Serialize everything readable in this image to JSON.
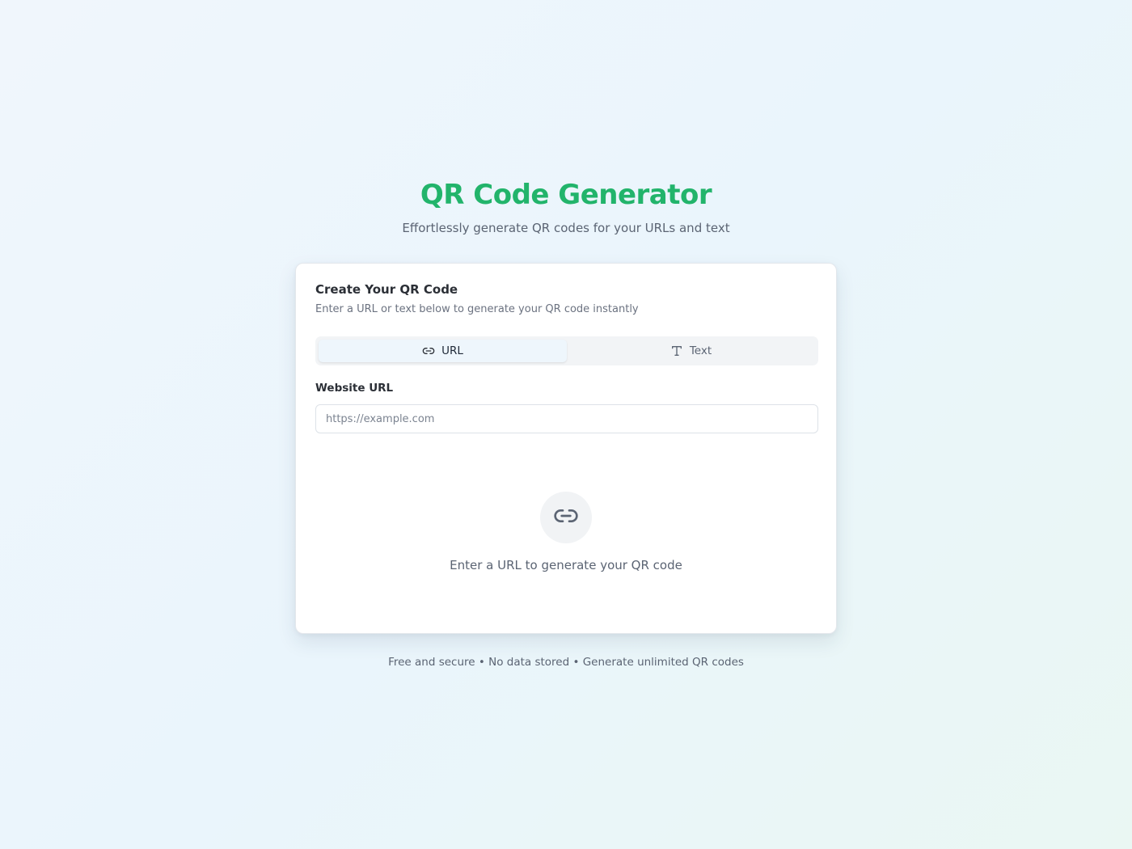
{
  "header": {
    "title": "QR Code Generator",
    "subtitle": "Effortlessly generate QR codes for your URLs and text"
  },
  "card": {
    "title": "Create Your QR Code",
    "description": "Enter a URL or text below to generate your QR code instantly",
    "tabs": [
      {
        "label": "URL",
        "icon": "link-icon",
        "active": true
      },
      {
        "label": "Text",
        "icon": "text-type-icon",
        "active": false
      }
    ],
    "url_field": {
      "label": "Website URL",
      "value": "",
      "placeholder": "https://example.com"
    },
    "empty_state": {
      "icon": "link-icon",
      "message": "Enter a URL to generate your QR code"
    }
  },
  "footer": {
    "text": "Free and secure • No data stored • Generate unlimited QR codes"
  },
  "colors": {
    "accent": "#22b46b",
    "background": "#eef6fc",
    "card": "#ffffff",
    "muted_text": "#5b6473"
  }
}
